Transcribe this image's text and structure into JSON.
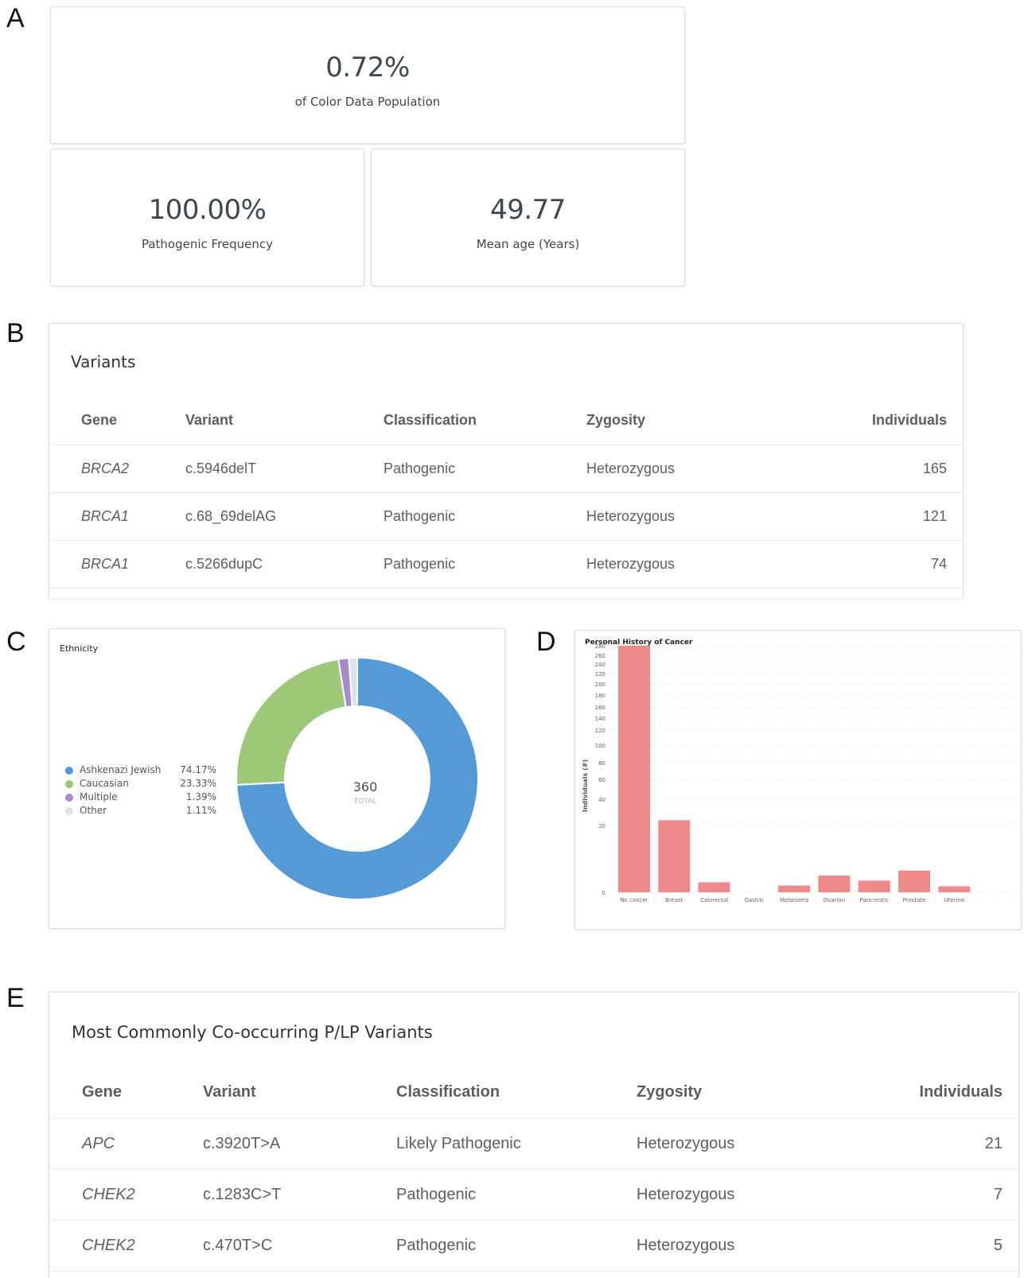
{
  "panels": {
    "a": "A",
    "b": "B",
    "c": "C",
    "d": "D",
    "e": "E"
  },
  "stats": {
    "population": {
      "value": "0.72%",
      "label": "of Color Data Population"
    },
    "frequency": {
      "value": "100.00%",
      "label": "Pathogenic Frequency"
    },
    "age": {
      "value": "49.77",
      "label": "Mean age (Years)"
    }
  },
  "variants": {
    "title": "Variants",
    "headers": {
      "gene": "Gene",
      "variant": "Variant",
      "classification": "Classification",
      "zygosity": "Zygosity",
      "individuals": "Individuals"
    },
    "rows": [
      {
        "gene": "BRCA2",
        "variant": "c.5946delT",
        "classification": "Pathogenic",
        "zygosity": "Heterozygous",
        "individuals": "165"
      },
      {
        "gene": "BRCA1",
        "variant": "c.68_69delAG",
        "classification": "Pathogenic",
        "zygosity": "Heterozygous",
        "individuals": "121"
      },
      {
        "gene": "BRCA1",
        "variant": "c.5266dupC",
        "classification": "Pathogenic",
        "zygosity": "Heterozygous",
        "individuals": "74"
      }
    ]
  },
  "ethnicity": {
    "title": "Ethnicity",
    "total_value": "360",
    "total_label": "TOTAL",
    "legend": [
      {
        "name": "Ashkenazi Jewish",
        "pct": "74.17%",
        "color": "#539bd6"
      },
      {
        "name": "Caucasian",
        "pct": "23.33%",
        "color": "#9cc878"
      },
      {
        "name": "Multiple",
        "pct": "1.39%",
        "color": "#a989c9"
      },
      {
        "name": "Other",
        "pct": "1.11%",
        "color": "#dde2e8"
      }
    ]
  },
  "cancer_chart": {
    "title": "Personal History of Cancer",
    "ylabel": "Individuals (#)",
    "bar_color": "#ef8a8a"
  },
  "cooccurring": {
    "title": "Most Commonly Co-occurring P/LP Variants",
    "headers": {
      "gene": "Gene",
      "variant": "Variant",
      "classification": "Classification",
      "zygosity": "Zygosity",
      "individuals": "Individuals"
    },
    "rows": [
      {
        "gene": "APC",
        "variant": "c.3920T>A",
        "classification": "Likely Pathogenic",
        "zygosity": "Heterozygous",
        "individuals": "21"
      },
      {
        "gene": "CHEK2",
        "variant": "c.1283C>T",
        "classification": "Pathogenic",
        "zygosity": "Heterozygous",
        "individuals": "7"
      },
      {
        "gene": "CHEK2",
        "variant": "c.470T>C",
        "classification": "Pathogenic",
        "zygosity": "Heterozygous",
        "individuals": "5"
      }
    ]
  },
  "chart_data": [
    {
      "type": "pie",
      "title": "Ethnicity",
      "categories": [
        "Ashkenazi Jewish",
        "Caucasian",
        "Multiple",
        "Other"
      ],
      "values": [
        74.17,
        23.33,
        1.39,
        1.11
      ],
      "colors": [
        "#539bd6",
        "#9cc878",
        "#a989c9",
        "#dde2e8"
      ],
      "total": 360,
      "legend": "left"
    },
    {
      "type": "bar",
      "title": "Personal History of Cancer",
      "categories": [
        "No cancer",
        "Breast",
        "Colorectal",
        "Gastric",
        "Melanoma",
        "Ovarian",
        "Pancreatic",
        "Prostate",
        "Uterine"
      ],
      "values": [
        280,
        24,
        3,
        0,
        2,
        5,
        3.5,
        6.5,
        1.8
      ],
      "xlabel": "",
      "ylabel": "Individuals (#)",
      "yticks": [
        0,
        20,
        40,
        60,
        80,
        100,
        120,
        140,
        160,
        180,
        200,
        220,
        240,
        260,
        280
      ],
      "ylim": [
        0,
        280
      ],
      "grid": true
    }
  ]
}
